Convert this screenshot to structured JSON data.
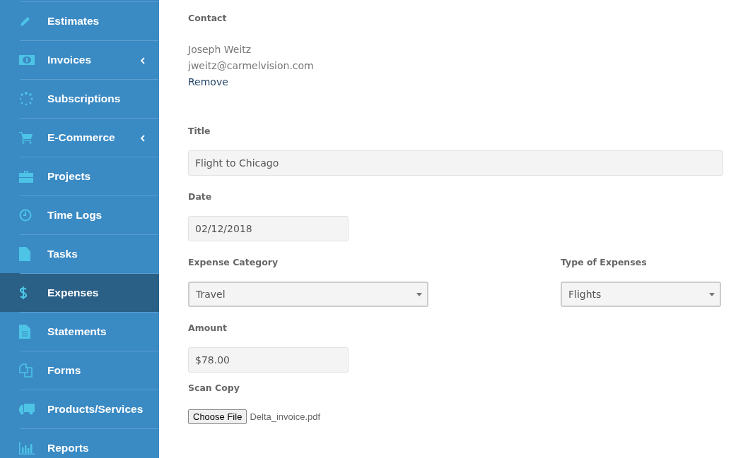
{
  "sidebar": {
    "items": [
      {
        "label": "Estimates",
        "selected": false,
        "has_submenu": false
      },
      {
        "label": "Invoices",
        "selected": false,
        "has_submenu": true
      },
      {
        "label": "Subscriptions",
        "selected": false,
        "has_submenu": false
      },
      {
        "label": "E-Commerce",
        "selected": false,
        "has_submenu": true
      },
      {
        "label": "Projects",
        "selected": false,
        "has_submenu": false
      },
      {
        "label": "Time Logs",
        "selected": false,
        "has_submenu": false
      },
      {
        "label": "Tasks",
        "selected": false,
        "has_submenu": false
      },
      {
        "label": "Expenses",
        "selected": true,
        "has_submenu": false
      },
      {
        "label": "Statements",
        "selected": false,
        "has_submenu": false
      },
      {
        "label": "Forms",
        "selected": false,
        "has_submenu": false
      },
      {
        "label": "Products/Services",
        "selected": false,
        "has_submenu": false
      },
      {
        "label": "Reports",
        "selected": false,
        "has_submenu": false
      }
    ]
  },
  "contact": {
    "label": "Contact",
    "name": "Joseph Weitz",
    "email": "jweitz@carmelvision.com",
    "remove_link": "Remove"
  },
  "title": {
    "label": "Title",
    "value": "Flight to Chicago"
  },
  "date": {
    "label": "Date",
    "value": "02/12/2018"
  },
  "expense_category": {
    "label": "Expense Category",
    "value": "Travel"
  },
  "type_of_expenses": {
    "label": "Type of Expenses",
    "value": "Flights"
  },
  "amount": {
    "label": "Amount",
    "value": "$78.00"
  },
  "scan_copy": {
    "label": "Scan Copy",
    "button": "Choose File",
    "file_name": "Delta_invoice.pdf"
  }
}
